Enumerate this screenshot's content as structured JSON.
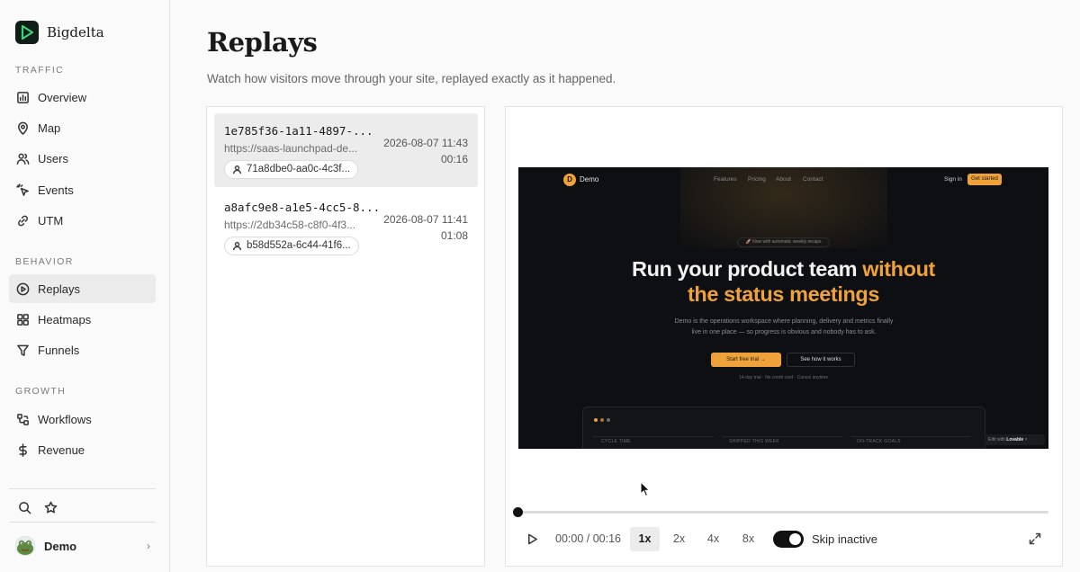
{
  "brand": {
    "name": "Bigdelta"
  },
  "sidebar": {
    "sections": [
      {
        "label": "TRAFFIC"
      },
      {
        "label": "BEHAVIOR"
      },
      {
        "label": "GROWTH"
      }
    ],
    "items": [
      {
        "label": "Overview",
        "icon": "chart-icon"
      },
      {
        "label": "Map",
        "icon": "map-pin-icon"
      },
      {
        "label": "Users",
        "icon": "users-icon"
      },
      {
        "label": "Events",
        "icon": "cursor-click-icon"
      },
      {
        "label": "UTM",
        "icon": "link-icon"
      },
      {
        "label": "Replays",
        "icon": "play-circle-icon",
        "active": true
      },
      {
        "label": "Heatmaps",
        "icon": "grid-icon"
      },
      {
        "label": "Funnels",
        "icon": "filter-icon"
      },
      {
        "label": "Workflows",
        "icon": "workflow-icon"
      },
      {
        "label": "Revenue",
        "icon": "dollar-icon"
      }
    ],
    "tools": [
      {
        "icon": "search-icon"
      },
      {
        "icon": "star-icon"
      }
    ],
    "account": {
      "name": "Demo",
      "chevron": "›"
    }
  },
  "page": {
    "title": "Replays",
    "subtitle": "Watch how visitors move through your site, replayed exactly as it happened."
  },
  "sessions": [
    {
      "id": "1e785f36-1a11-4897-...",
      "url": "https://saas-launchpad-de...",
      "date": "2026-08-07 11:43",
      "duration": "00:16",
      "user": "71a8dbe0-aa0c-4c3f...",
      "selected": true
    },
    {
      "id": "a8afc9e8-a1e5-4cc5-8...",
      "url": "https://2db34c58-c8f0-4f3...",
      "date": "2026-08-07 11:41",
      "duration": "01:08",
      "user": "b58d552a-6c44-41f6...",
      "selected": false
    }
  ],
  "replay": {
    "logo_letter": "D",
    "brand": "Demo",
    "nav": [
      "Features",
      "Pricing",
      "About",
      "Contact"
    ],
    "signin": "Sign in",
    "cta": "Get started",
    "pill": "🚀 Now with automatic weekly recaps",
    "headline_1": "Run your product team ",
    "headline_accent_1": "without",
    "headline_accent_2": "the status meetings",
    "body_1": "Demo is the operations workspace where planning, delivery and metrics finally",
    "body_2": "live in one place — so progress is obvious and nobody has to ask.",
    "btn_primary": "Start free trial →",
    "btn_secondary": "See how it works",
    "note": "14-day trial · No credit card · Cancel anytime",
    "stats": [
      "CYCLE TIME",
      "SHIPPED THIS WEEK",
      "ON-TRACK GOALS"
    ],
    "badge_prefix": "Edit with",
    "badge_brand": "Lovable",
    "badge_close": "×",
    "accent": "#f0a23a"
  },
  "player": {
    "time": "00:00 / 00:16",
    "progress": 0,
    "speeds": [
      {
        "label": "1x",
        "active": true
      },
      {
        "label": "2x",
        "active": false
      },
      {
        "label": "4x",
        "active": false
      },
      {
        "label": "8x",
        "active": false
      }
    ],
    "skip_inactive_label": "Skip inactive",
    "skip_inactive": true
  }
}
